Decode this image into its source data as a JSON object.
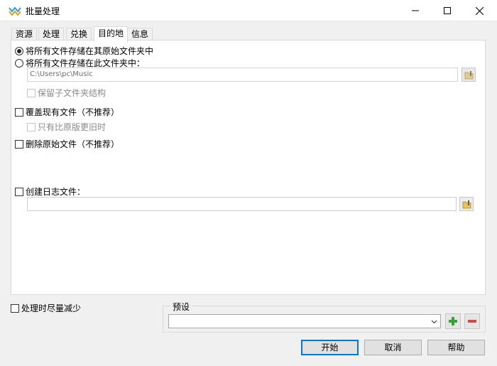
{
  "window": {
    "title": "批量处理"
  },
  "tabs": [
    {
      "label": "资源"
    },
    {
      "label": "处理"
    },
    {
      "label": "兑换"
    },
    {
      "label": "目的地",
      "active": true
    },
    {
      "label": "信息"
    }
  ],
  "destination": {
    "save_in_original_label": "将所有文件存储在其原始文件夹中",
    "save_in_folder_label": "将所有文件存储在此文件夹中：",
    "folder_path": "C:\\Users\\pc\\Music",
    "keep_structure_label": "保留子文件夹结构",
    "overwrite_label": "覆盖现有文件（不推荐）",
    "only_older_label": "只有比原版更旧时",
    "delete_original_label": "删除原始文件（不推荐）",
    "create_log_label": "创建日志文件：",
    "log_path": ""
  },
  "bottom": {
    "minimize_label": "处理时尽量减少",
    "preset_title": "预设",
    "preset_value": "",
    "start_label": "开始",
    "cancel_label": "取消",
    "help_label": "帮助"
  },
  "colors": {
    "accent": "#0078d7",
    "add": "#3aa03a",
    "remove": "#d04848",
    "folder": "#e6c35c"
  }
}
